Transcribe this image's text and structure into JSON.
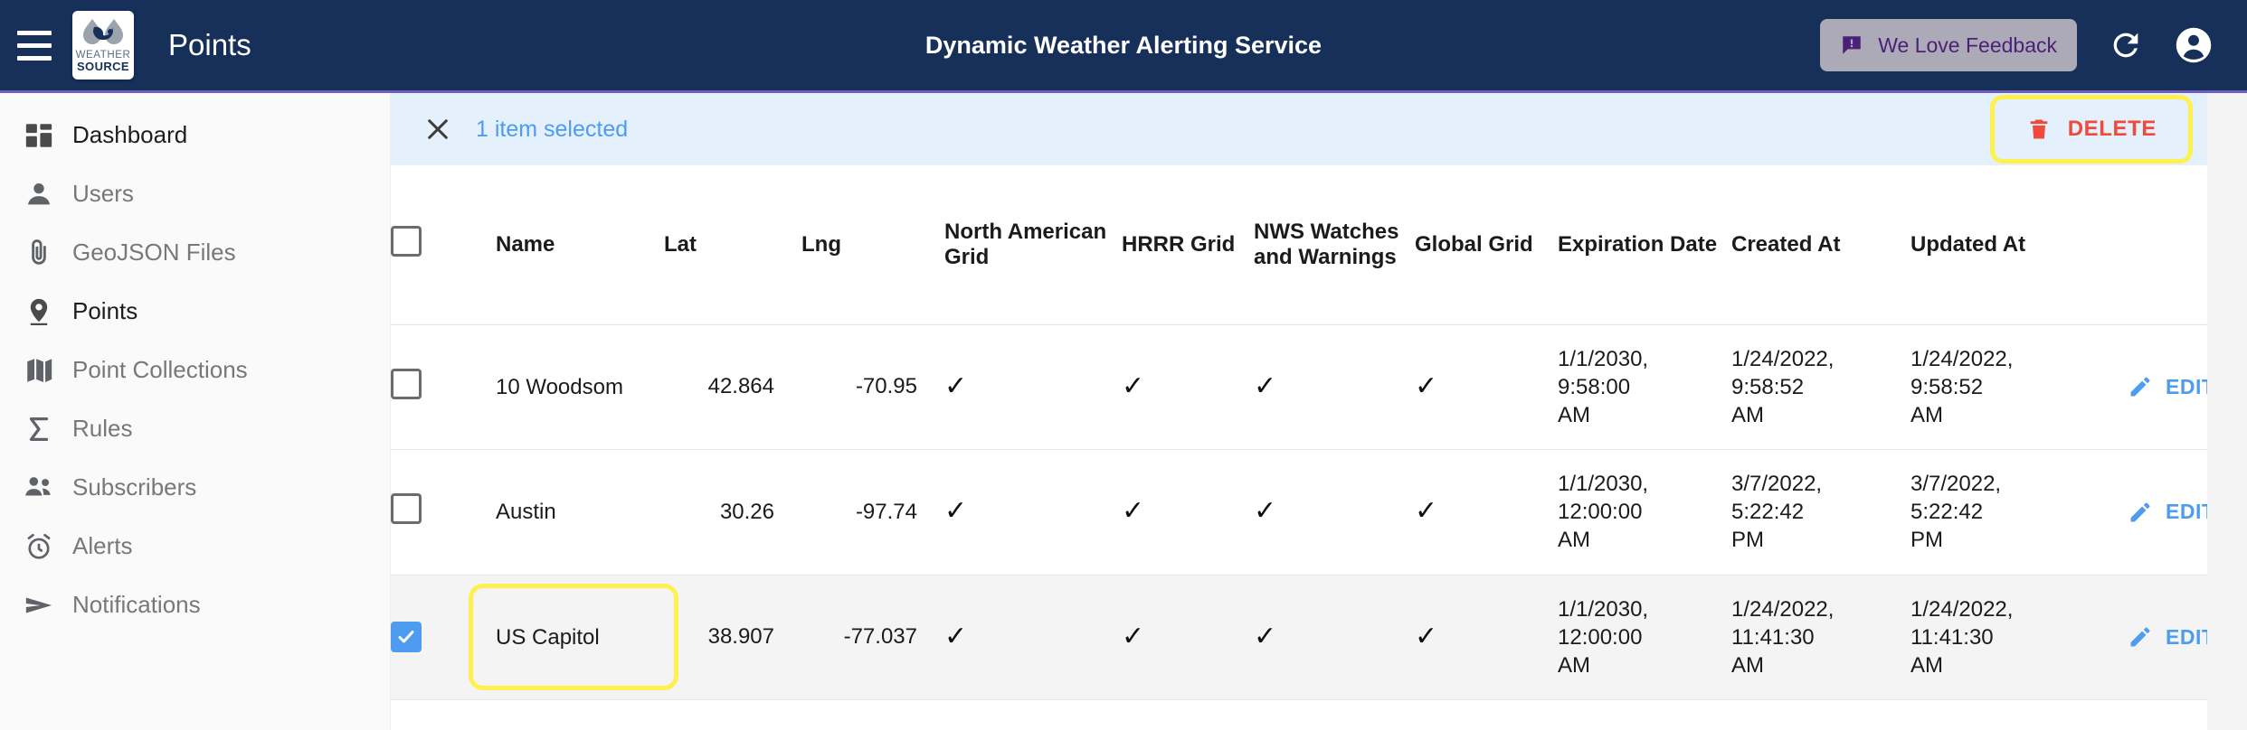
{
  "appbar": {
    "menu_icon": "hamburger-icon",
    "brand": "Points",
    "logo_line1": "WEATHER",
    "logo_line2": "SOURCE",
    "title": "Dynamic Weather Alerting Service",
    "feedback_label": "We Love Feedback",
    "feedback_icon": "feedback-bubble-icon",
    "refresh_icon": "refresh-icon",
    "account_icon": "account-circle-icon",
    "bg_color": "#16305a",
    "accent_underline": "#6d5fc4",
    "feedback_bg": "#adaab8",
    "feedback_text_color": "#4b2178"
  },
  "sidebar": {
    "items": [
      {
        "label": "Dashboard",
        "icon": "dashboard-icon",
        "active": true
      },
      {
        "label": "Users",
        "icon": "person-icon",
        "active": false
      },
      {
        "label": "GeoJSON Files",
        "icon": "attachment-icon",
        "active": false
      },
      {
        "label": "Points",
        "icon": "location-pin-icon",
        "active": true
      },
      {
        "label": "Point Collections",
        "icon": "map-icon",
        "active": false
      },
      {
        "label": "Rules",
        "icon": "sigma-icon",
        "active": false
      },
      {
        "label": "Subscribers",
        "icon": "people-group-icon",
        "active": false
      },
      {
        "label": "Alerts",
        "icon": "alarm-clock-icon",
        "active": false
      },
      {
        "label": "Notifications",
        "icon": "send-paper-plane-icon",
        "active": false
      }
    ]
  },
  "selection_bar": {
    "close_icon": "close-x-icon",
    "status_text": "1 item selected",
    "status_color": "#4d9cf0",
    "bg_color": "#e4f0fb",
    "delete_label": "DELETE",
    "delete_icon": "trash-icon",
    "delete_color": "#ef4a3c",
    "highlight_color": "#fff04d"
  },
  "table": {
    "columns": [
      "",
      "Name",
      "Lat",
      "Lng",
      "North American Grid",
      "HRRR Grid",
      "NWS Watches and Warnings",
      "Global Grid",
      "Expiration Date",
      "Created At",
      "Updated At",
      ""
    ],
    "header_checkbox_checked": false,
    "check_glyph": "✓",
    "action_label": "EDIT",
    "action_icon": "pencil-edit-icon",
    "rows": [
      {
        "selected": false,
        "name": "10 Woodsom",
        "lat": "42.864",
        "lng": "-70.95",
        "north_american_grid": true,
        "hrrr_grid": true,
        "nws_watches_and_warnings": true,
        "global_grid": true,
        "expiration_date": "1/1/2030, 9:58:00 AM",
        "created_at": "1/24/2022, 9:58:52 AM",
        "updated_at": "1/24/2022, 9:58:52 AM"
      },
      {
        "selected": false,
        "name": "Austin",
        "lat": "30.26",
        "lng": "-97.74",
        "north_american_grid": true,
        "hrrr_grid": true,
        "nws_watches_and_warnings": true,
        "global_grid": true,
        "expiration_date": "1/1/2030, 12:00:00 AM",
        "created_at": "3/7/2022, 5:22:42 PM",
        "updated_at": "3/7/2022, 5:22:42 PM"
      },
      {
        "selected": true,
        "name": "US Capitol",
        "lat": "38.907",
        "lng": "-77.037",
        "north_american_grid": true,
        "hrrr_grid": true,
        "nws_watches_and_warnings": true,
        "global_grid": true,
        "expiration_date": "1/1/2030, 12:00:00 AM",
        "created_at": "1/24/2022, 11:41:30 AM",
        "updated_at": "1/24/2022, 11:41:30 AM"
      }
    ]
  }
}
